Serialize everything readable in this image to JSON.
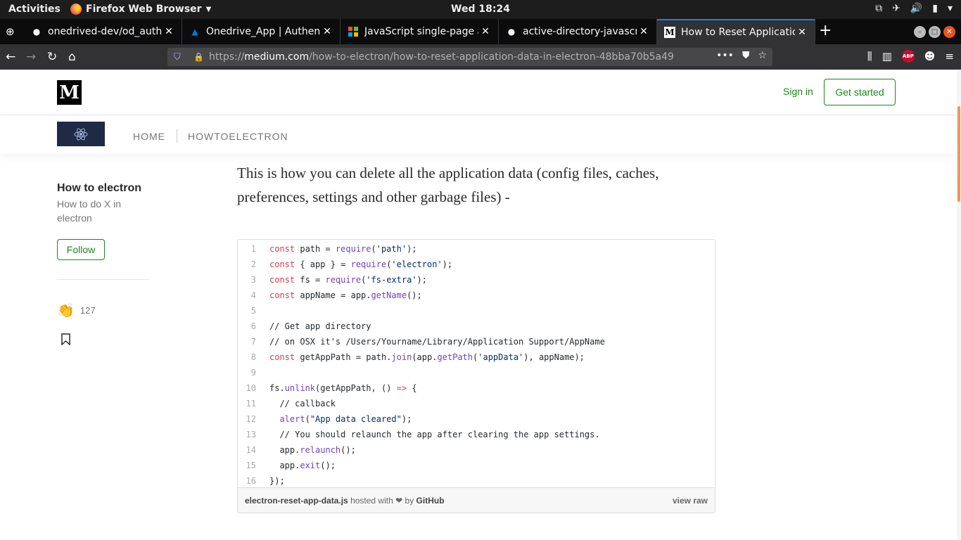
{
  "system_bar": {
    "activities": "Activities",
    "app_name": "Firefox Web Browser",
    "clock": "Wed 18:24"
  },
  "tabs": [
    {
      "title": "onedrived-dev/od_auth.p",
      "favicon": "github-icon"
    },
    {
      "title": "Onedrive_App | Authenti",
      "favicon": "azure-icon"
    },
    {
      "title": "JavaScript single-page ap",
      "favicon": "microsoft-icon"
    },
    {
      "title": "active-directory-javascrip",
      "favicon": "github-icon"
    },
    {
      "title": "How to Reset Application",
      "favicon": "medium-icon",
      "active": true
    }
  ],
  "url": {
    "prefix": "https://",
    "domain": "medium.com",
    "path": "/how-to-electron/how-to-reset-application-data-in-electron-48bba70b5a49"
  },
  "medium": {
    "logo": "M",
    "signin": "Sign in",
    "get_started": "Get started"
  },
  "publication": {
    "nav": [
      "HOME",
      "HOWTOELECTRON"
    ]
  },
  "sidebar": {
    "title": "How to electron",
    "description": "How to do X in electron",
    "follow": "Follow",
    "claps": "127"
  },
  "article": {
    "paragraph": "This is how you can delete all the application data (config files, caches, preferences, settings and other garbage files) -"
  },
  "gist": {
    "lines": [
      "const path = require('path');",
      "const { app } = require('electron');",
      "const fs = require('fs-extra');",
      "const appName = app.getName();",
      "",
      "// Get app directory",
      "// on OSX it's /Users/Yourname/Library/Application Support/AppName",
      "const getAppPath = path.join(app.getPath('appData'), appName);",
      "",
      "fs.unlink(getAppPath, () => {",
      "  // callback",
      "  alert(\"App data cleared\");",
      "  // You should relaunch the app after clearing the app settings.",
      "  app.relaunch();",
      "  app.exit();",
      "});"
    ],
    "footer_file": "electron-reset-app-data.js",
    "footer_hosted": "hosted with",
    "footer_heart": "❤",
    "footer_by": "by",
    "footer_github": "GitHub",
    "view_raw": "view raw"
  },
  "colors": {
    "medium_green": "#1a8917",
    "tab_accent": "#0a84ff",
    "scroll_thumb": "#f2935c"
  }
}
